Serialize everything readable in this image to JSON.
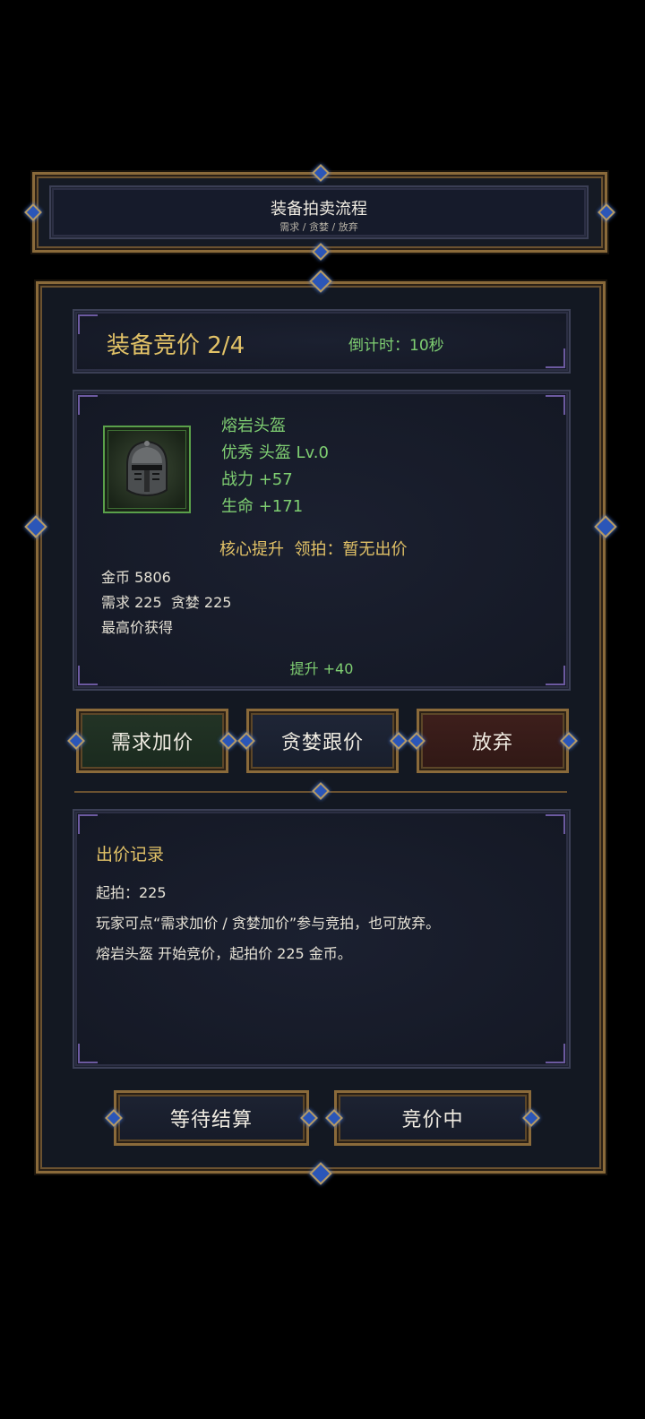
{
  "flow_header": {
    "title": "装备拍卖流程",
    "subtitle": "需求 / 贪婪 / 放弃"
  },
  "auction": {
    "title": "装备竞价 2/4",
    "countdown": "倒计时：10秒"
  },
  "item": {
    "icon": "helmet-icon",
    "name": "熔岩头盔",
    "quality_type": "优秀 头盔 Lv.0",
    "power": "战力 +57",
    "life": "生命 +171",
    "core_lead": "核心提升  领拍：暂无出价",
    "gold": "金币 5806",
    "need_greed": "需求 225  贪婪 225",
    "rule": "最高价获得",
    "upgrade": "提升 +40"
  },
  "actions": {
    "need_label": "需求加价",
    "greed_label": "贪婪跟价",
    "pass_label": "放弃"
  },
  "log": {
    "title": "出价记录",
    "lines": [
      "起拍：225",
      "玩家可点“需求加价 / 贪婪加价”参与竞拍，也可放弃。",
      "熔岩头盔 开始竞价，起拍价 225 金币。"
    ]
  },
  "footer": {
    "wait_label": "等待结算",
    "bidding_label": "竞价中"
  },
  "colors": {
    "gold_text": "#e2c267",
    "green_text": "#7fcf72",
    "gem_blue": "#2b56b8"
  }
}
